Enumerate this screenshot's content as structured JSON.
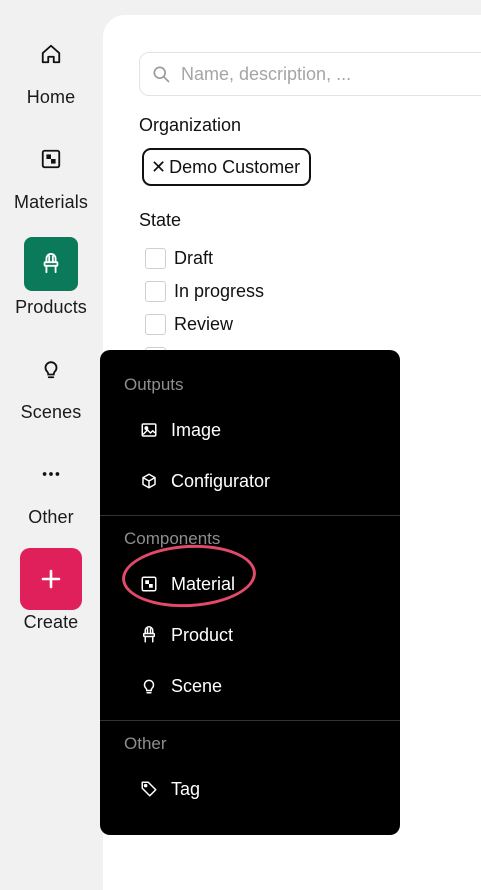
{
  "sidebar": {
    "items": [
      {
        "label": "Home",
        "icon": "home-icon"
      },
      {
        "label": "Materials",
        "icon": "material-icon"
      },
      {
        "label": "Products",
        "icon": "chair-icon",
        "active": true
      },
      {
        "label": "Scenes",
        "icon": "lightbulb-icon"
      },
      {
        "label": "Other",
        "icon": "more-icon"
      }
    ],
    "create_label": "Create",
    "active_color": "#0b7a5b",
    "create_color": "#e0205a"
  },
  "filters": {
    "search_placeholder": "Name, description, ...",
    "organization_title": "Organization",
    "organization_chip": "Demo Customer",
    "state_title": "State",
    "states": [
      "Draft",
      "In progress",
      "Review"
    ]
  },
  "menu": {
    "outputs_header": "Outputs",
    "outputs": [
      {
        "label": "Image",
        "icon": "image-icon"
      },
      {
        "label": "Configurator",
        "icon": "cube-icon"
      }
    ],
    "components_header": "Components",
    "components": [
      {
        "label": "Material",
        "icon": "material-icon"
      },
      {
        "label": "Product",
        "icon": "chair-icon"
      },
      {
        "label": "Scene",
        "icon": "lightbulb-icon"
      }
    ],
    "other_header": "Other",
    "other": [
      {
        "label": "Tag",
        "icon": "tag-icon"
      }
    ],
    "highlight_color": "#e24a6a"
  }
}
